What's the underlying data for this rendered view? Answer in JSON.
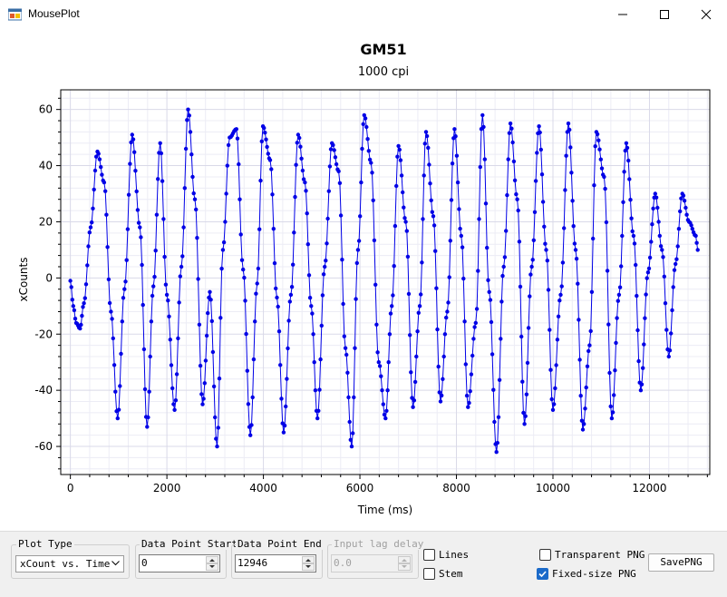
{
  "window": {
    "title": "MousePlot"
  },
  "chart_data": {
    "type": "scatter",
    "title": "GM51",
    "subtitle": "1000 cpi",
    "xlabel": "Time (ms)",
    "ylabel": "xCounts",
    "xlim": [
      -200,
      13250
    ],
    "ylim": [
      -70,
      67
    ],
    "xticks": [
      0,
      2000,
      4000,
      6000,
      8000,
      10000,
      12000
    ],
    "yticks": [
      -60,
      -40,
      -20,
      0,
      20,
      40,
      60
    ],
    "x_tick_labels": [
      "0",
      "2000",
      "4000",
      "6000",
      "8000",
      "10000",
      "12000"
    ],
    "y_tick_labels": [
      "-60",
      "-40",
      "-20",
      "0",
      "20",
      "40",
      "60"
    ],
    "grid": true,
    "marker": "dot",
    "lines": true,
    "color": "#0000e6",
    "x": [
      0,
      60,
      120,
      200,
      280,
      420,
      560,
      700,
      840,
      980,
      1120,
      1280,
      1440,
      1590,
      1720,
      1860,
      2000,
      2160,
      2300,
      2440,
      2580,
      2740,
      2890,
      3040,
      3160,
      3300,
      3440,
      3580,
      3730,
      3870,
      3990,
      4140,
      4280,
      4420,
      4570,
      4720,
      4860,
      4990,
      5120,
      5270,
      5420,
      5560,
      5700,
      5830,
      5960,
      6090,
      6230,
      6390,
      6530,
      6660,
      6800,
      6950,
      7100,
      7240,
      7370,
      7520,
      7670,
      7810,
      7960,
      8100,
      8240,
      8400,
      8540,
      8680,
      8830,
      8980,
      9120,
      9260,
      9410,
      9560,
      9710,
      9860,
      10000,
      10160,
      10320,
      10470,
      10620,
      10760,
      10900,
      11060,
      11220,
      11370,
      11520,
      11670,
      11820,
      11970,
      12120,
      12260,
      12400,
      12540,
      12680,
      12820,
      12960,
      13000
    ],
    "y": [
      -1,
      -10,
      -16,
      -18,
      -9,
      18,
      45,
      34,
      -12,
      -50,
      -4,
      51,
      18,
      -53,
      -3,
      48,
      -6,
      -47,
      4,
      60,
      28,
      -45,
      -5,
      -60,
      10,
      50,
      53,
      3,
      -56,
      -2,
      54,
      42,
      -7,
      -55,
      -6,
      51,
      34,
      -10,
      -50,
      4,
      48,
      38,
      -25,
      -60,
      10,
      58,
      41,
      -30,
      -50,
      -10,
      47,
      20,
      -46,
      -10,
      52,
      22,
      -44,
      -12,
      53,
      15,
      -46,
      -16,
      58,
      -5,
      -62,
      4,
      55,
      28,
      -52,
      4,
      54,
      10,
      -47,
      -6,
      55,
      10,
      -54,
      -24,
      52,
      36,
      -50,
      -6,
      48,
      15,
      -40,
      2,
      30,
      10,
      -28,
      5,
      30,
      20,
      15,
      10
    ]
  },
  "controls": {
    "plot_type_label": "Plot Type",
    "plot_type_value": "xCount vs. Time",
    "start_label": "Data Point Start",
    "start_value": "0",
    "end_label": "Data Point End",
    "end_value": "12946",
    "lag_label": "Input lag delay",
    "lag_value": "0.0",
    "lines_label": "Lines",
    "lines_checked": false,
    "stem_label": "Stem",
    "stem_checked": false,
    "transparent_label": "Transparent PNG",
    "transparent_checked": false,
    "fixed_label": "Fixed-size PNG",
    "fixed_checked": true,
    "save_label": "SavePNG"
  },
  "icons": {
    "app": "app-icon",
    "minimize": "minimize-icon",
    "maximize": "maximize-icon",
    "close": "close-icon"
  }
}
